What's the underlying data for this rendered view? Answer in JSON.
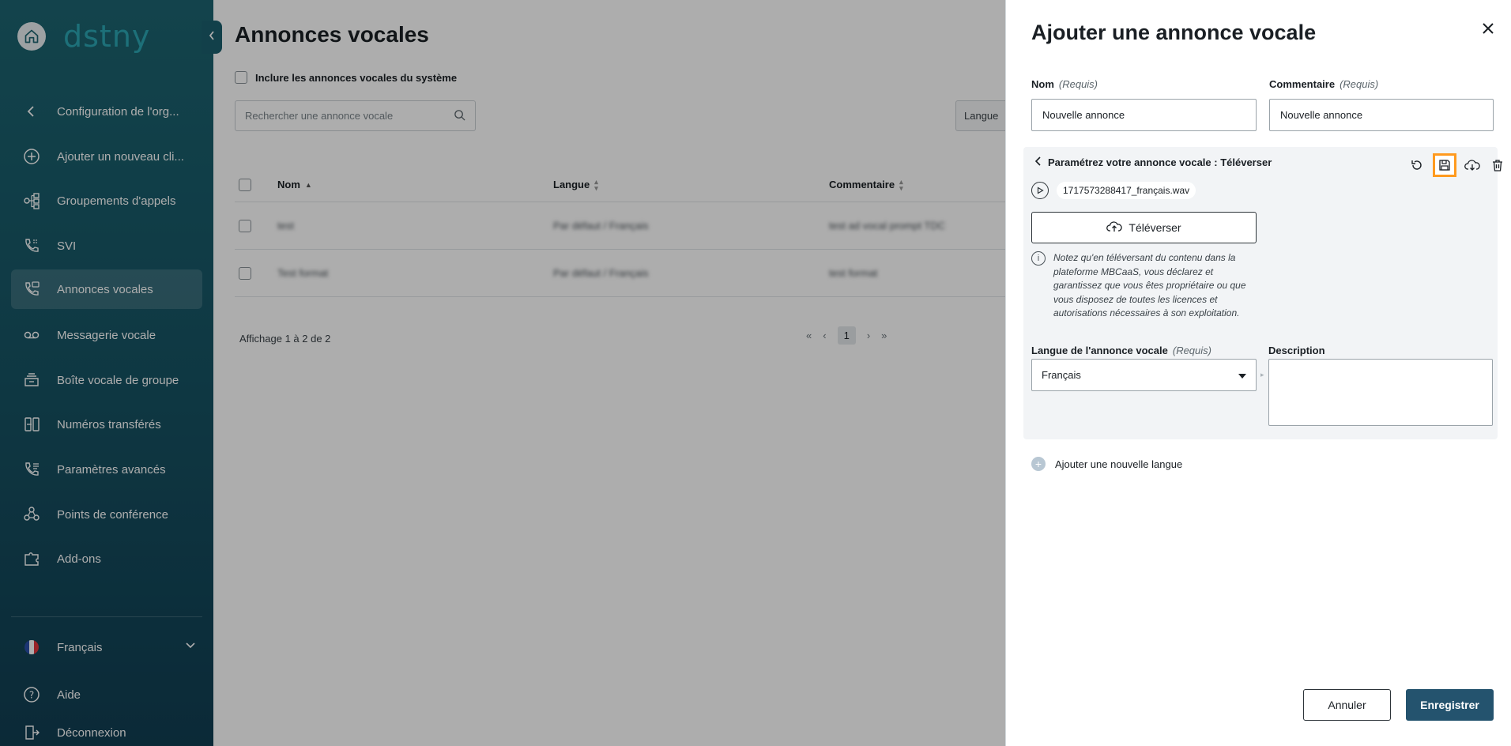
{
  "sidebar": {
    "brand": "dstny",
    "items": [
      {
        "label": "Configuration de l'org...",
        "icon": "chevron-left-icon"
      },
      {
        "label": "Ajouter un nouveau cli...",
        "icon": "plus-circle-icon"
      },
      {
        "label": "Groupements d'appels",
        "icon": "hunt-group-icon"
      },
      {
        "label": "SVI",
        "icon": "ivr-phone-icon"
      },
      {
        "label": "Annonces vocales",
        "icon": "announcement-icon",
        "active": true
      },
      {
        "label": "Messagerie vocale",
        "icon": "voicemail-icon"
      },
      {
        "label": "Boîte vocale de groupe",
        "icon": "group-voicemail-icon"
      },
      {
        "label": "Numéros transférés",
        "icon": "forwarded-numbers-icon"
      },
      {
        "label": "Paramètres avancés",
        "icon": "advanced-settings-icon"
      },
      {
        "label": "Points de conférence",
        "icon": "conference-icon"
      },
      {
        "label": "Add-ons",
        "icon": "addons-icon"
      }
    ],
    "language": "Français",
    "help": "Aide",
    "logout": "Déconnexion"
  },
  "main": {
    "title": "Annonces vocales",
    "include_system_label": "Inclure les annonces vocales du système",
    "search_placeholder": "Rechercher une annonce vocale",
    "language_filter": "Langue",
    "columns": [
      "Nom",
      "Langue",
      "Commentaire"
    ],
    "rows": [
      {
        "name": "test",
        "language": "Par défaut / Français",
        "comment": "test ad vocal prompt TDC"
      },
      {
        "name": "Test format",
        "language": "Par défaut / Français",
        "comment": "test format"
      }
    ],
    "count_text": "Affichage 1 à 2 de 2",
    "pager": {
      "first": "«",
      "prev": "‹",
      "page": "1",
      "next": "›",
      "last": "»"
    }
  },
  "drawer": {
    "title": "Ajouter une annonce vocale",
    "name_label": "Nom",
    "comment_label": "Commentaire",
    "required": "(Requis)",
    "name_value": "Nouvelle annonce",
    "comment_value": "Nouvelle annonce",
    "config_title": "Paramétrez votre annonce vocale : Téléverser",
    "file_name": "1717573288417_français.wav",
    "upload_label": "Téléverser",
    "note": "Notez qu'en téléversant du contenu dans la plateforme MBCaaS, vous déclarez et garantissez que vous êtes propriétaire ou que vous disposez de toutes les licences et autorisations nécessaires à son exploitation.",
    "language_label": "Langue de l'annonce vocale",
    "language_value": "Français",
    "description_label": "Description",
    "add_language": "Ajouter une nouvelle langue",
    "cancel": "Annuler",
    "save": "Enregistrer"
  },
  "colors": {
    "sidebar": "#175565",
    "accent": "#2ba6b3",
    "primary_button": "#24536e",
    "highlight": "#ff9a1f"
  }
}
